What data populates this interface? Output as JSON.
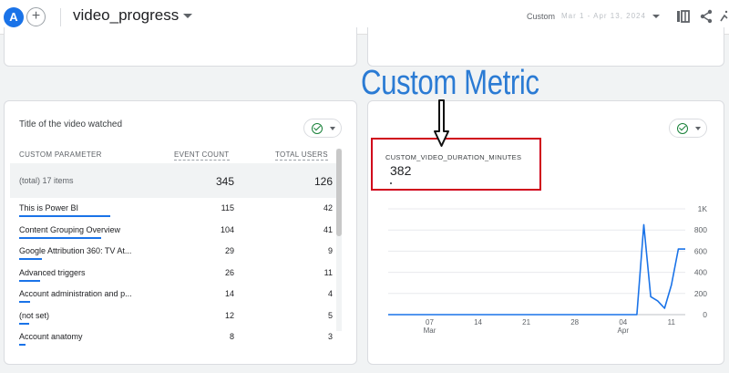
{
  "header": {
    "avatar_letter": "A",
    "add_label": "+",
    "title": "video_progress",
    "date_range_label": "Custom",
    "date_range_value": "Mar 1 - Apr 13, 2024"
  },
  "annotation": {
    "text": "Custom Metric"
  },
  "table_card": {
    "title": "Title of the video watched",
    "columns": {
      "dimension": "CUSTOM PARAMETER",
      "events": "EVENT COUNT",
      "users": "TOTAL USERS"
    },
    "total": {
      "label": "(total) 17 items",
      "events": "345",
      "users": "126"
    },
    "rows": [
      {
        "name": "This is Power BI",
        "events": "115",
        "users": "42",
        "share": 0.333
      },
      {
        "name": "Content Grouping Overview",
        "events": "104",
        "users": "41",
        "share": 0.301
      },
      {
        "name": "Google Attribution 360: TV At...",
        "events": "29",
        "users": "9",
        "share": 0.084
      },
      {
        "name": "Advanced triggers",
        "events": "26",
        "users": "11",
        "share": 0.075
      },
      {
        "name": "Account administration and p...",
        "events": "14",
        "users": "4",
        "share": 0.041
      },
      {
        "name": "(not set)",
        "events": "12",
        "users": "5",
        "share": 0.035
      },
      {
        "name": "Account anatomy",
        "events": "8",
        "users": "3",
        "share": 0.023
      }
    ]
  },
  "metric_card": {
    "metric_name": "CUSTOM_VIDEO_DURATION_MINUTES",
    "metric_value": "382"
  },
  "chart_data": {
    "type": "line",
    "title": "",
    "xlabel": "",
    "ylabel": "",
    "y_tick_labels": [
      "1K",
      "800",
      "600",
      "400",
      "200",
      "0"
    ],
    "y_ticks": [
      1000,
      800,
      600,
      400,
      200,
      0
    ],
    "ylim": [
      0,
      1000
    ],
    "x_tick_labels": [
      {
        "day": "07",
        "month": "Mar"
      },
      {
        "day": "14",
        "month": ""
      },
      {
        "day": "21",
        "month": ""
      },
      {
        "day": "28",
        "month": ""
      },
      {
        "day": "04",
        "month": "Apr"
      },
      {
        "day": "11",
        "month": ""
      }
    ],
    "x_tick_days": [
      7,
      14,
      21,
      28,
      35,
      42
    ],
    "xlim": [
      1,
      44
    ],
    "grid": true,
    "series": [
      {
        "color": "#1a73e8",
        "x": [
          1,
          2,
          3,
          4,
          5,
          6,
          7,
          8,
          9,
          10,
          11,
          12,
          13,
          14,
          15,
          16,
          17,
          18,
          19,
          20,
          21,
          22,
          23,
          24,
          25,
          26,
          27,
          28,
          29,
          30,
          31,
          32,
          33,
          34,
          35,
          36,
          37,
          38,
          39,
          40,
          41,
          42,
          43,
          44
        ],
        "values": [
          0,
          0,
          0,
          0,
          0,
          0,
          0,
          0,
          0,
          0,
          0,
          0,
          0,
          0,
          0,
          0,
          0,
          0,
          0,
          0,
          0,
          0,
          0,
          0,
          0,
          0,
          0,
          0,
          0,
          0,
          0,
          0,
          0,
          0,
          0,
          0,
          0,
          850,
          170,
          130,
          60,
          280,
          620,
          620
        ]
      }
    ]
  }
}
